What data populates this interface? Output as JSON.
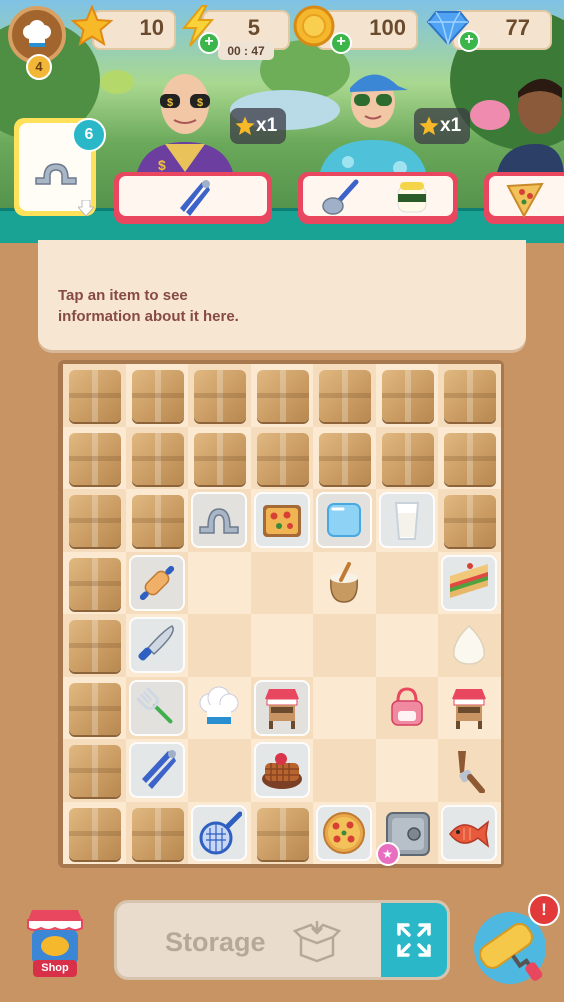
{
  "header": {
    "level": "4",
    "stars": "10",
    "energy": "5",
    "energy_timer": "00 : 47",
    "coins": "100",
    "gems": "77"
  },
  "orders": {
    "pinned_count": "6",
    "customer_1_reward": "x1",
    "customer_2_reward": "x1"
  },
  "info_panel": {
    "text_line1": "Tap an item to see",
    "text_line2": "information about it here."
  },
  "board": {
    "rows": [
      [
        "box",
        "box",
        "box",
        "box",
        "box",
        "box",
        "box"
      ],
      [
        "box",
        "box",
        "box",
        "box",
        "box",
        "box",
        "box"
      ],
      [
        "box",
        "box",
        "bubble:clamp",
        "bubble:pizza-slice",
        "bubble:ice-cube",
        "bubble:milk-glass",
        "box"
      ],
      [
        "box",
        "bubble:rolling-pin",
        "empty",
        "empty",
        "flour-sack",
        "empty",
        "bubble:sandwich"
      ],
      [
        "box",
        "bubble:knife",
        "empty",
        "empty",
        "empty",
        "empty",
        "rice-ball"
      ],
      [
        "box",
        "bubble:fork",
        "chef-hat",
        "bubble:food-stand",
        "empty",
        "handbag",
        "food-stand"
      ],
      [
        "box",
        "bubble:tongs",
        "empty",
        "bubble:waffle",
        "empty",
        "empty",
        "meat-grinder"
      ],
      [
        "box",
        "box",
        "bubble:sieve",
        "box",
        "bubble:pizza",
        "safe",
        "bubble:fish"
      ]
    ]
  },
  "bottom": {
    "storage_label": "Storage",
    "shop_label": "Shop",
    "alert": "!"
  },
  "colors": {
    "teal": "#19a394",
    "order_red": "#e9465f",
    "panel": "#f6e6d2",
    "panel_text": "#874a45",
    "wood": "#c99463"
  }
}
